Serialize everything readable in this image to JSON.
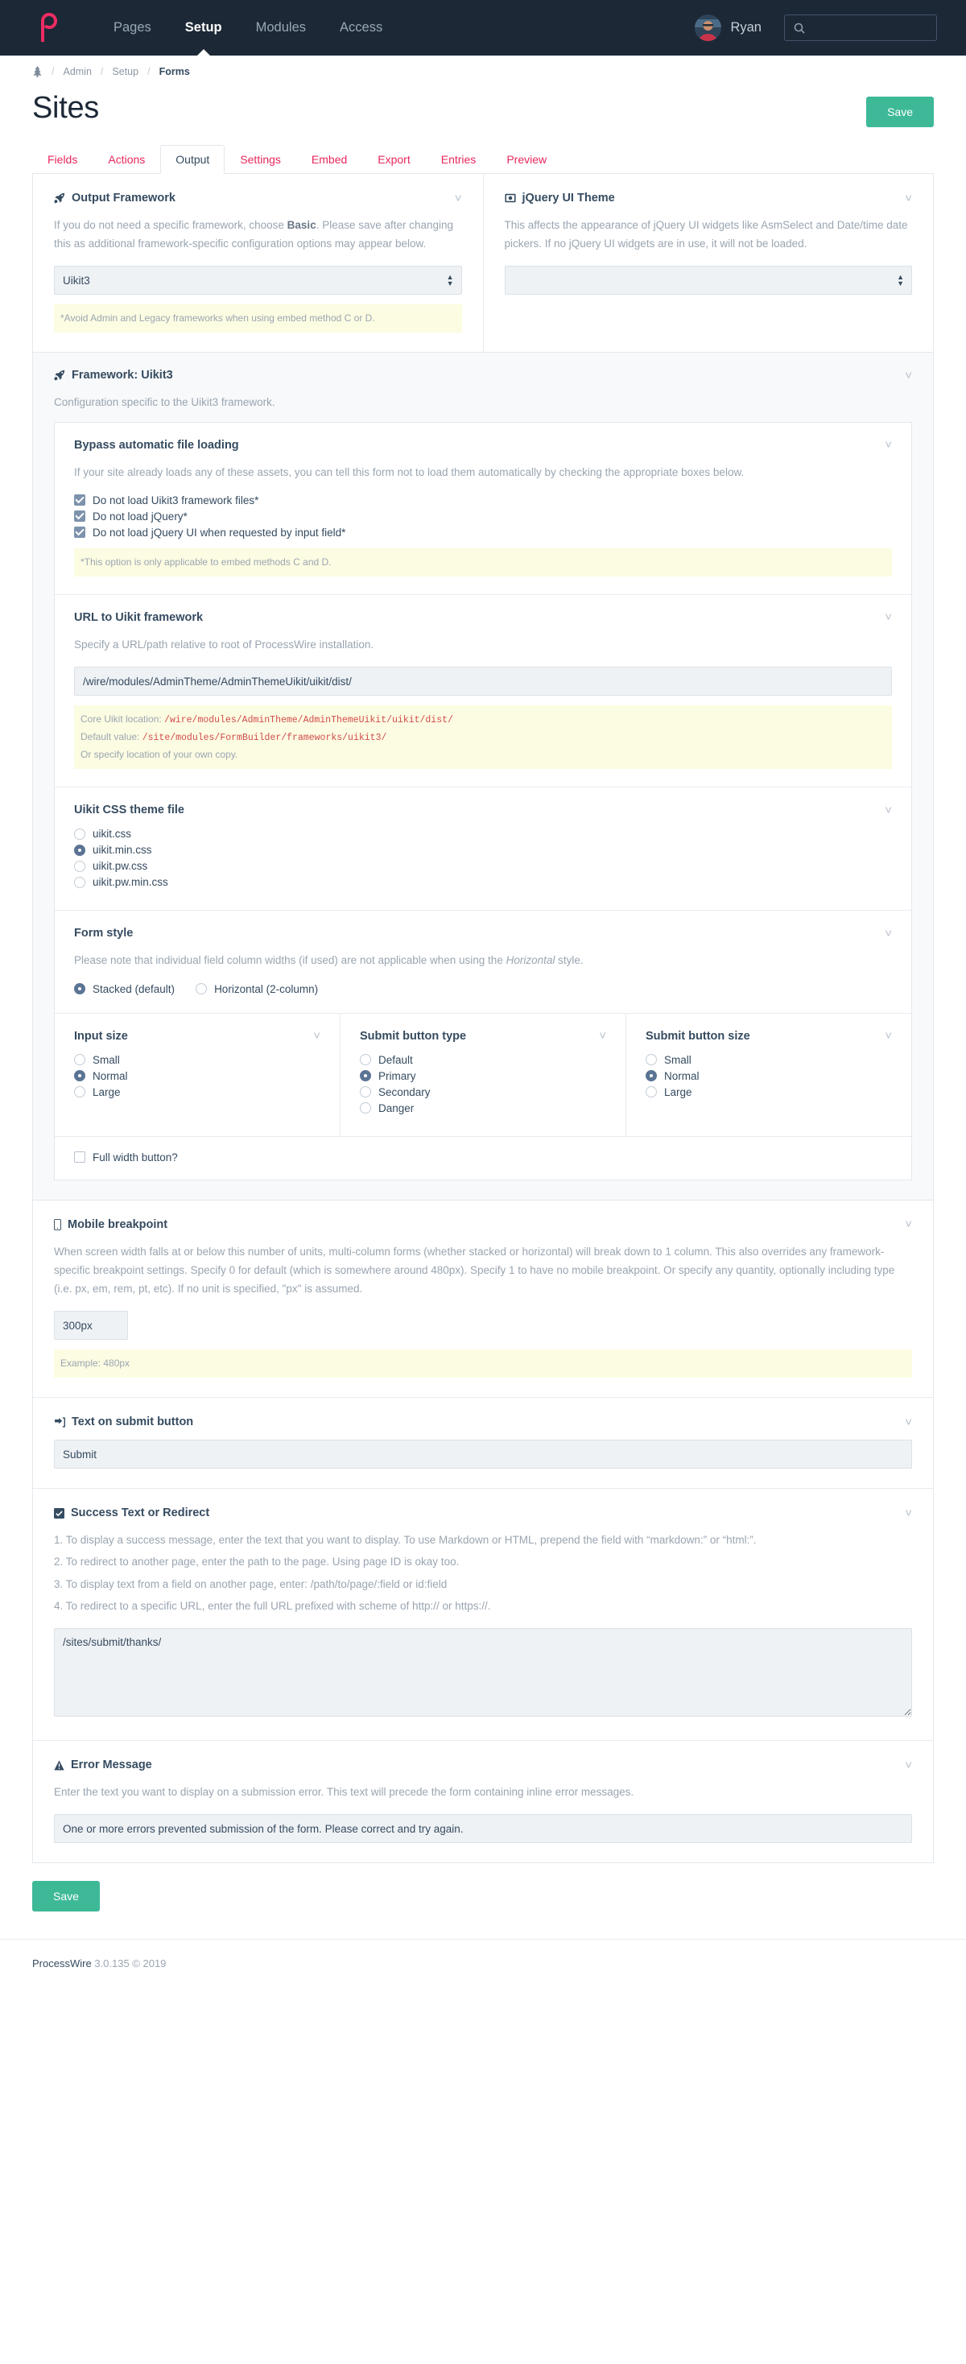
{
  "masthead": {
    "logo_name": "processwire-logo",
    "nav": [
      {
        "label": "Pages",
        "active": false
      },
      {
        "label": "Setup",
        "active": true
      },
      {
        "label": "Modules",
        "active": false
      },
      {
        "label": "Access",
        "active": false
      }
    ],
    "user": "Ryan",
    "search_placeholder": ""
  },
  "breadcrumb": {
    "home_icon": "tree-icon",
    "items": [
      "Admin",
      "Setup",
      "Forms"
    ]
  },
  "page": {
    "title": "Sites",
    "save_label": "Save"
  },
  "tabs": [
    {
      "label": "Fields",
      "active": false
    },
    {
      "label": "Actions",
      "active": false
    },
    {
      "label": "Output",
      "active": true
    },
    {
      "label": "Settings",
      "active": false
    },
    {
      "label": "Embed",
      "active": false
    },
    {
      "label": "Export",
      "active": false
    },
    {
      "label": "Entries",
      "active": false
    },
    {
      "label": "Preview",
      "active": false
    }
  ],
  "output_framework": {
    "icon": "rocket-icon",
    "title": "Output Framework",
    "description_1": "If you do not need a specific framework, choose ",
    "description_bold": "Basic",
    "description_2": ". Please save after changing this as additional framework-specific configuration options may appear below.",
    "value": "Uikit3",
    "note": "*Avoid Admin and Legacy frameworks when using embed method C or D."
  },
  "jquery_ui_theme": {
    "icon": "image-icon",
    "title": "jQuery UI Theme",
    "description": "This affects the appearance of jQuery UI widgets like AsmSelect and Date/time date pickers. If no jQuery UI widgets are in use, it will not be loaded.",
    "value": ""
  },
  "framework": {
    "icon": "rocket-icon",
    "title": "Framework: Uikit3",
    "description": "Configuration specific to the Uikit3 framework.",
    "bypass": {
      "title": "Bypass automatic file loading",
      "description": "If your site already loads any of these assets, you can tell this form not to load them automatically by checking the appropriate boxes below.",
      "options": [
        {
          "label": "Do not load Uikit3 framework files*",
          "checked": true
        },
        {
          "label": "Do not load jQuery*",
          "checked": true
        },
        {
          "label": "Do not load jQuery UI when requested by input field*",
          "checked": true
        }
      ],
      "note": "*This option is only applicable to embed methods C and D."
    },
    "url": {
      "title": "URL to Uikit framework",
      "description": "Specify a URL/path relative to root of ProcessWire installation.",
      "value": "/wire/modules/AdminTheme/AdminThemeUikit/uikit/dist/",
      "note_core_label": "Core Uikit location: ",
      "note_core_path": "/wire/modules/AdminTheme/AdminThemeUikit/uikit/dist/",
      "note_default_label": "Default value: ",
      "note_default_path": "/site/modules/FormBuilder/frameworks/uikit3/",
      "note_last": "Or specify location of your own copy."
    },
    "css_theme": {
      "title": "Uikit CSS theme file",
      "options": [
        {
          "label": "uikit.css",
          "selected": false
        },
        {
          "label": "uikit.min.css",
          "selected": true
        },
        {
          "label": "uikit.pw.css",
          "selected": false
        },
        {
          "label": "uikit.pw.min.css",
          "selected": false
        }
      ]
    },
    "form_style": {
      "title": "Form style",
      "description_1": "Please note that individual field column widths (if used) are not applicable when using the ",
      "description_italic": "Horizontal",
      "description_2": " style.",
      "options": [
        {
          "label": "Stacked (default)",
          "selected": true
        },
        {
          "label": "Horizontal (2-column)",
          "selected": false
        }
      ]
    },
    "input_size": {
      "title": "Input size",
      "options": [
        {
          "label": "Small",
          "selected": false
        },
        {
          "label": "Normal",
          "selected": true
        },
        {
          "label": "Large",
          "selected": false
        }
      ]
    },
    "submit_button_type": {
      "title": "Submit button type",
      "options": [
        {
          "label": "Default",
          "selected": false
        },
        {
          "label": "Primary",
          "selected": true
        },
        {
          "label": "Secondary",
          "selected": false
        },
        {
          "label": "Danger",
          "selected": false
        }
      ]
    },
    "submit_button_size": {
      "title": "Submit button size",
      "options": [
        {
          "label": "Small",
          "selected": false
        },
        {
          "label": "Normal",
          "selected": true
        },
        {
          "label": "Large",
          "selected": false
        }
      ]
    },
    "full_width": {
      "label": "Full width button?",
      "checked": false
    }
  },
  "mobile_breakpoint": {
    "icon": "mobile-icon",
    "title": "Mobile breakpoint",
    "description": "When screen width falls at or below this number of units, multi-column forms (whether stacked or horizontal) will break down to 1 column. This also overrides any framework-specific breakpoint settings. Specify 0 for default (which is somewhere around 480px). Specify 1 to have no mobile breakpoint. Or specify any quantity, optionally including type (i.e. px, em, rem, pt, etc). If no unit is specified, \"px\" is assumed.",
    "value": "300px",
    "note": "Example: 480px"
  },
  "submit_text": {
    "icon": "sign-in-icon",
    "title": "Text on submit button",
    "value": "Submit"
  },
  "success": {
    "icon": "check-square-icon",
    "title": "Success Text or Redirect",
    "lines": [
      "1. To display a success message, enter the text that you want to display. To use Markdown or HTML, prepend the field with “markdown:” or “html:”.",
      "2. To redirect to another page, enter the path to the page. Using page ID is okay too.",
      "3. To display text from a field on another page, enter: /path/to/page/:field or id:field",
      "4. To redirect to a specific URL, enter the full URL prefixed with scheme of http:// or https://."
    ],
    "value": "/sites/submit/thanks/"
  },
  "error": {
    "icon": "warning-icon",
    "title": "Error Message",
    "description": "Enter the text you want to display on a submission error. This text will precede the form containing inline error messages.",
    "value": "One or more errors prevented submission of the form. Please correct and try again."
  },
  "bottom_save": "Save",
  "footer": {
    "name": "ProcessWire",
    "version": "3.0.135 © 2019"
  },
  "colors": {
    "masthead_bg": "#1c2836",
    "accent_pink": "#e8275e",
    "save_green": "#3eb998",
    "note_bg": "#fcfce2",
    "path_red": "#d14b4b"
  }
}
